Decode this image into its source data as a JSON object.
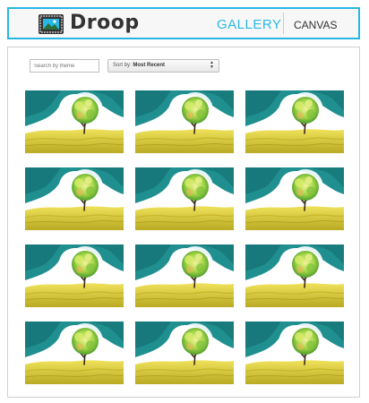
{
  "header": {
    "brand": "Droop",
    "nav": {
      "gallery": "GALLERY",
      "canvas": "CANVAS"
    }
  },
  "toolbar": {
    "search_placeholder": "Search by theme",
    "sort_label": "Sort by:",
    "sort_value": "Most Recent"
  },
  "gallery": {
    "rows": 4,
    "columns": 3,
    "artwork": "tree-on-hill-painting"
  },
  "colors": {
    "accent": "#29b8e6",
    "sky": "#1f8f90",
    "hill": "#d9cc3a"
  }
}
